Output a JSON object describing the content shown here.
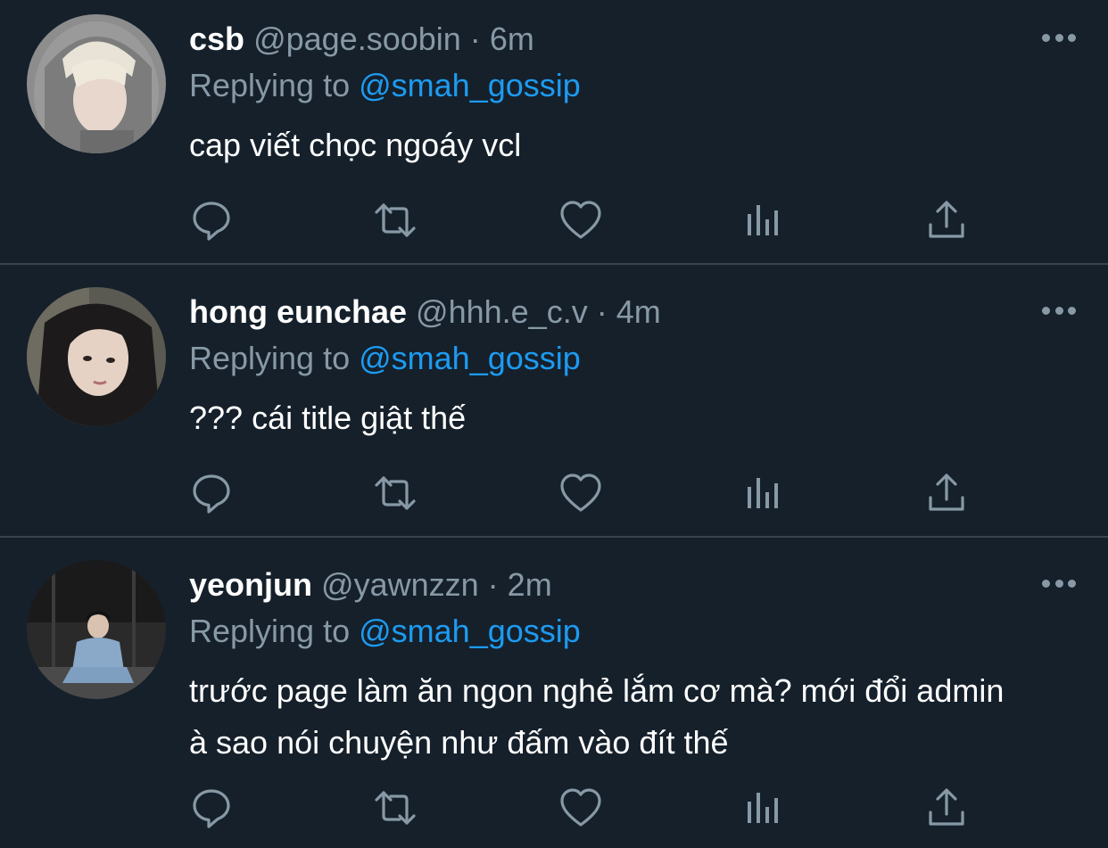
{
  "replying_label": "Replying to",
  "tweets": [
    {
      "name": "csb",
      "handle": "@page.soobin",
      "separator": "·",
      "time": "6m",
      "replying_to": "@smah_gossip",
      "text": "cap viết chọc ngoáy vcl"
    },
    {
      "name": "hong eunchae",
      "handle": "@hhh.e_c.v",
      "separator": "·",
      "time": "4m",
      "replying_to": "@smah_gossip",
      "text": "??? cái title giật thế"
    },
    {
      "name": "yeonjun",
      "handle": "@yawnzzn",
      "separator": "·",
      "time": "2m",
      "replying_to": "@smah_gossip",
      "text": "trước page làm ăn ngon nghẻ lắm cơ mà? mới đổi admin à sao nói chuyện như đấm vào đít thế"
    }
  ],
  "icons": {
    "reply": "reply-icon",
    "retweet": "retweet-icon",
    "like": "like-icon",
    "analytics": "analytics-icon",
    "share": "share-icon",
    "more": "more-icon"
  },
  "colors": {
    "background": "#15202b",
    "divider": "#38444d",
    "secondary_text": "#8899a6",
    "link": "#1d9bf0",
    "primary_text": "#ffffff"
  }
}
